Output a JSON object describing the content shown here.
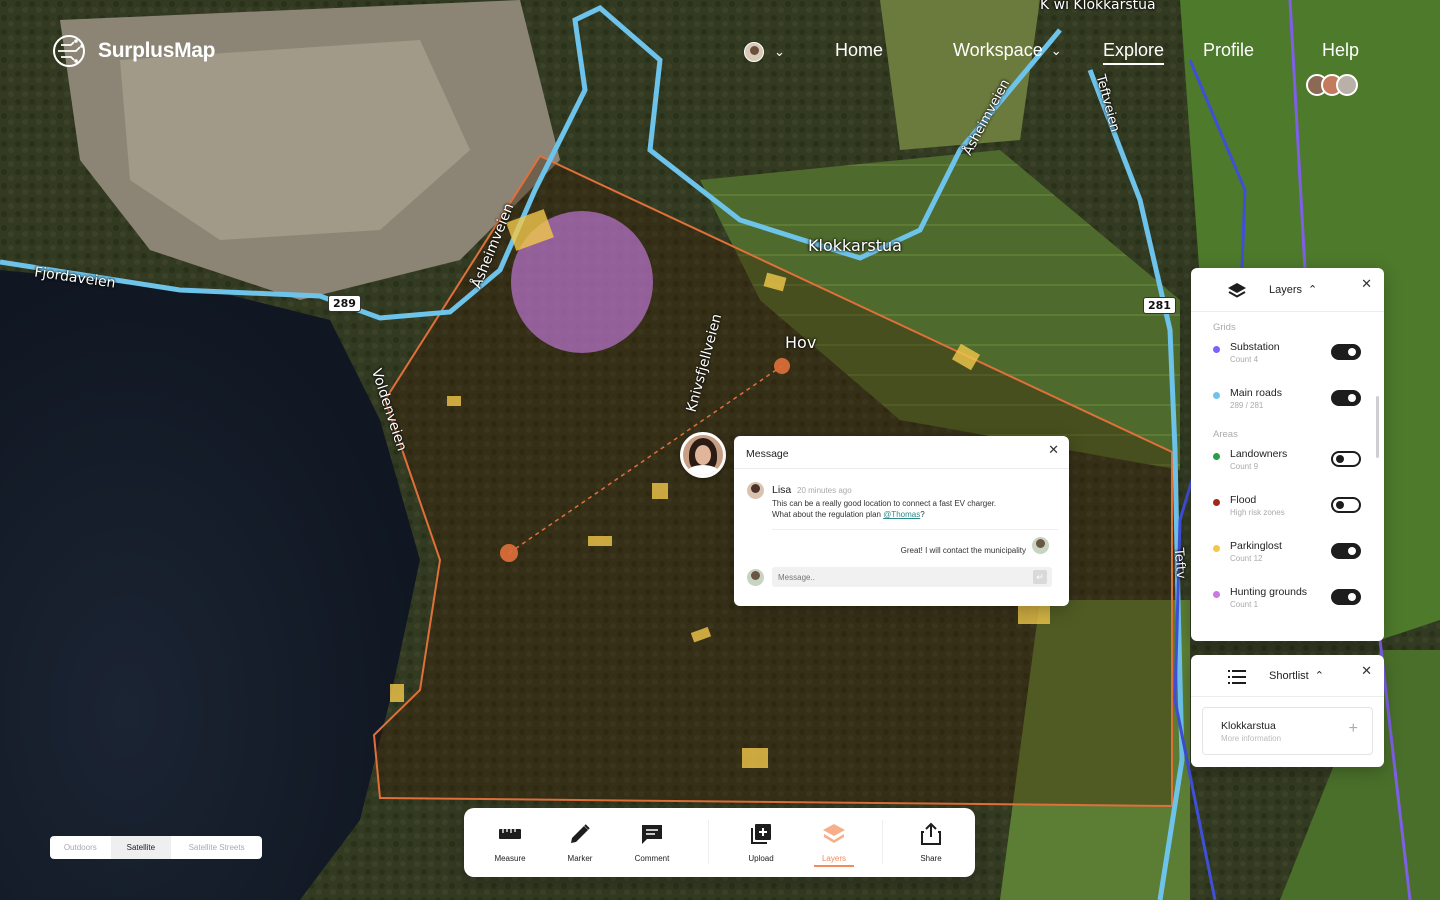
{
  "app": {
    "name": "SurplusMap"
  },
  "nav": {
    "items": [
      {
        "label": "Home"
      },
      {
        "label": "Workspace"
      },
      {
        "label": "Explore"
      },
      {
        "label": "Profile"
      },
      {
        "label": "Help"
      }
    ],
    "active": "Explore"
  },
  "map": {
    "labels": {
      "top": "K wi Klokkarstua",
      "fjordaveien": "Fjordaveien",
      "asheimveien": "Åsheimveien",
      "asheimveien2": "Åsheimveien",
      "klokkarstua": "Klokkarstua",
      "hov": "Hov",
      "knivsfjellveien": "Knivsfjellveien",
      "voldenveien": "Voldenveien",
      "teftveien": "Teftveien",
      "teftveien2": "Teftv"
    },
    "shields": {
      "r289": "289",
      "r281": "281"
    },
    "colors": {
      "area_outline": "#e0703a",
      "main_road": "#6ec3ea",
      "substation": "#6f58e0",
      "hunting": "#c77be0",
      "parking": "#f2c84b"
    }
  },
  "layers_panel": {
    "title": "Layers",
    "sections": [
      {
        "title": "Grids",
        "items": [
          {
            "name": "Substation",
            "sub": "Count 4",
            "color": "#7b61ff",
            "on": true
          },
          {
            "name": "Main roads",
            "sub": "289 / 281",
            "color": "#6ec3ea",
            "on": true
          }
        ]
      },
      {
        "title": "Areas",
        "items": [
          {
            "name": "Landowners",
            "sub": "Count 9",
            "color": "#2a9d4a",
            "on": false
          },
          {
            "name": "Flood",
            "sub": "High risk zones",
            "color": "#a1261c",
            "on": false
          },
          {
            "name": "Parkinglost",
            "sub": "Count 12",
            "color": "#f2c84b",
            "on": true
          },
          {
            "name": "Hunting grounds",
            "sub": "Count 1",
            "color": "#c77be0",
            "on": true
          }
        ]
      }
    ]
  },
  "shortlist_panel": {
    "title": "Shortlist",
    "item": {
      "title": "Klokkarstua",
      "sub": "More information"
    }
  },
  "message_panel": {
    "title": "Message",
    "author": "Lisa",
    "time": "20 minutes ago",
    "body_line1": "This can be a really good location to connect a fast EV charger.",
    "body_line2": "What about the regulation plan ",
    "mention": "@Thomas",
    "body_end": "?",
    "reply": "Great! I will contact the municipality",
    "input_placeholder": "Message.."
  },
  "map_styles": {
    "options": [
      "Outdoors",
      "Satellite",
      "Satellite Streets"
    ],
    "active": "Satellite"
  },
  "toolbar": {
    "tools": [
      {
        "label": "Measure"
      },
      {
        "label": "Marker"
      },
      {
        "label": "Comment"
      },
      {
        "label": "Upload"
      },
      {
        "label": "Layers"
      },
      {
        "label": "Share"
      }
    ],
    "active": "Layers"
  }
}
